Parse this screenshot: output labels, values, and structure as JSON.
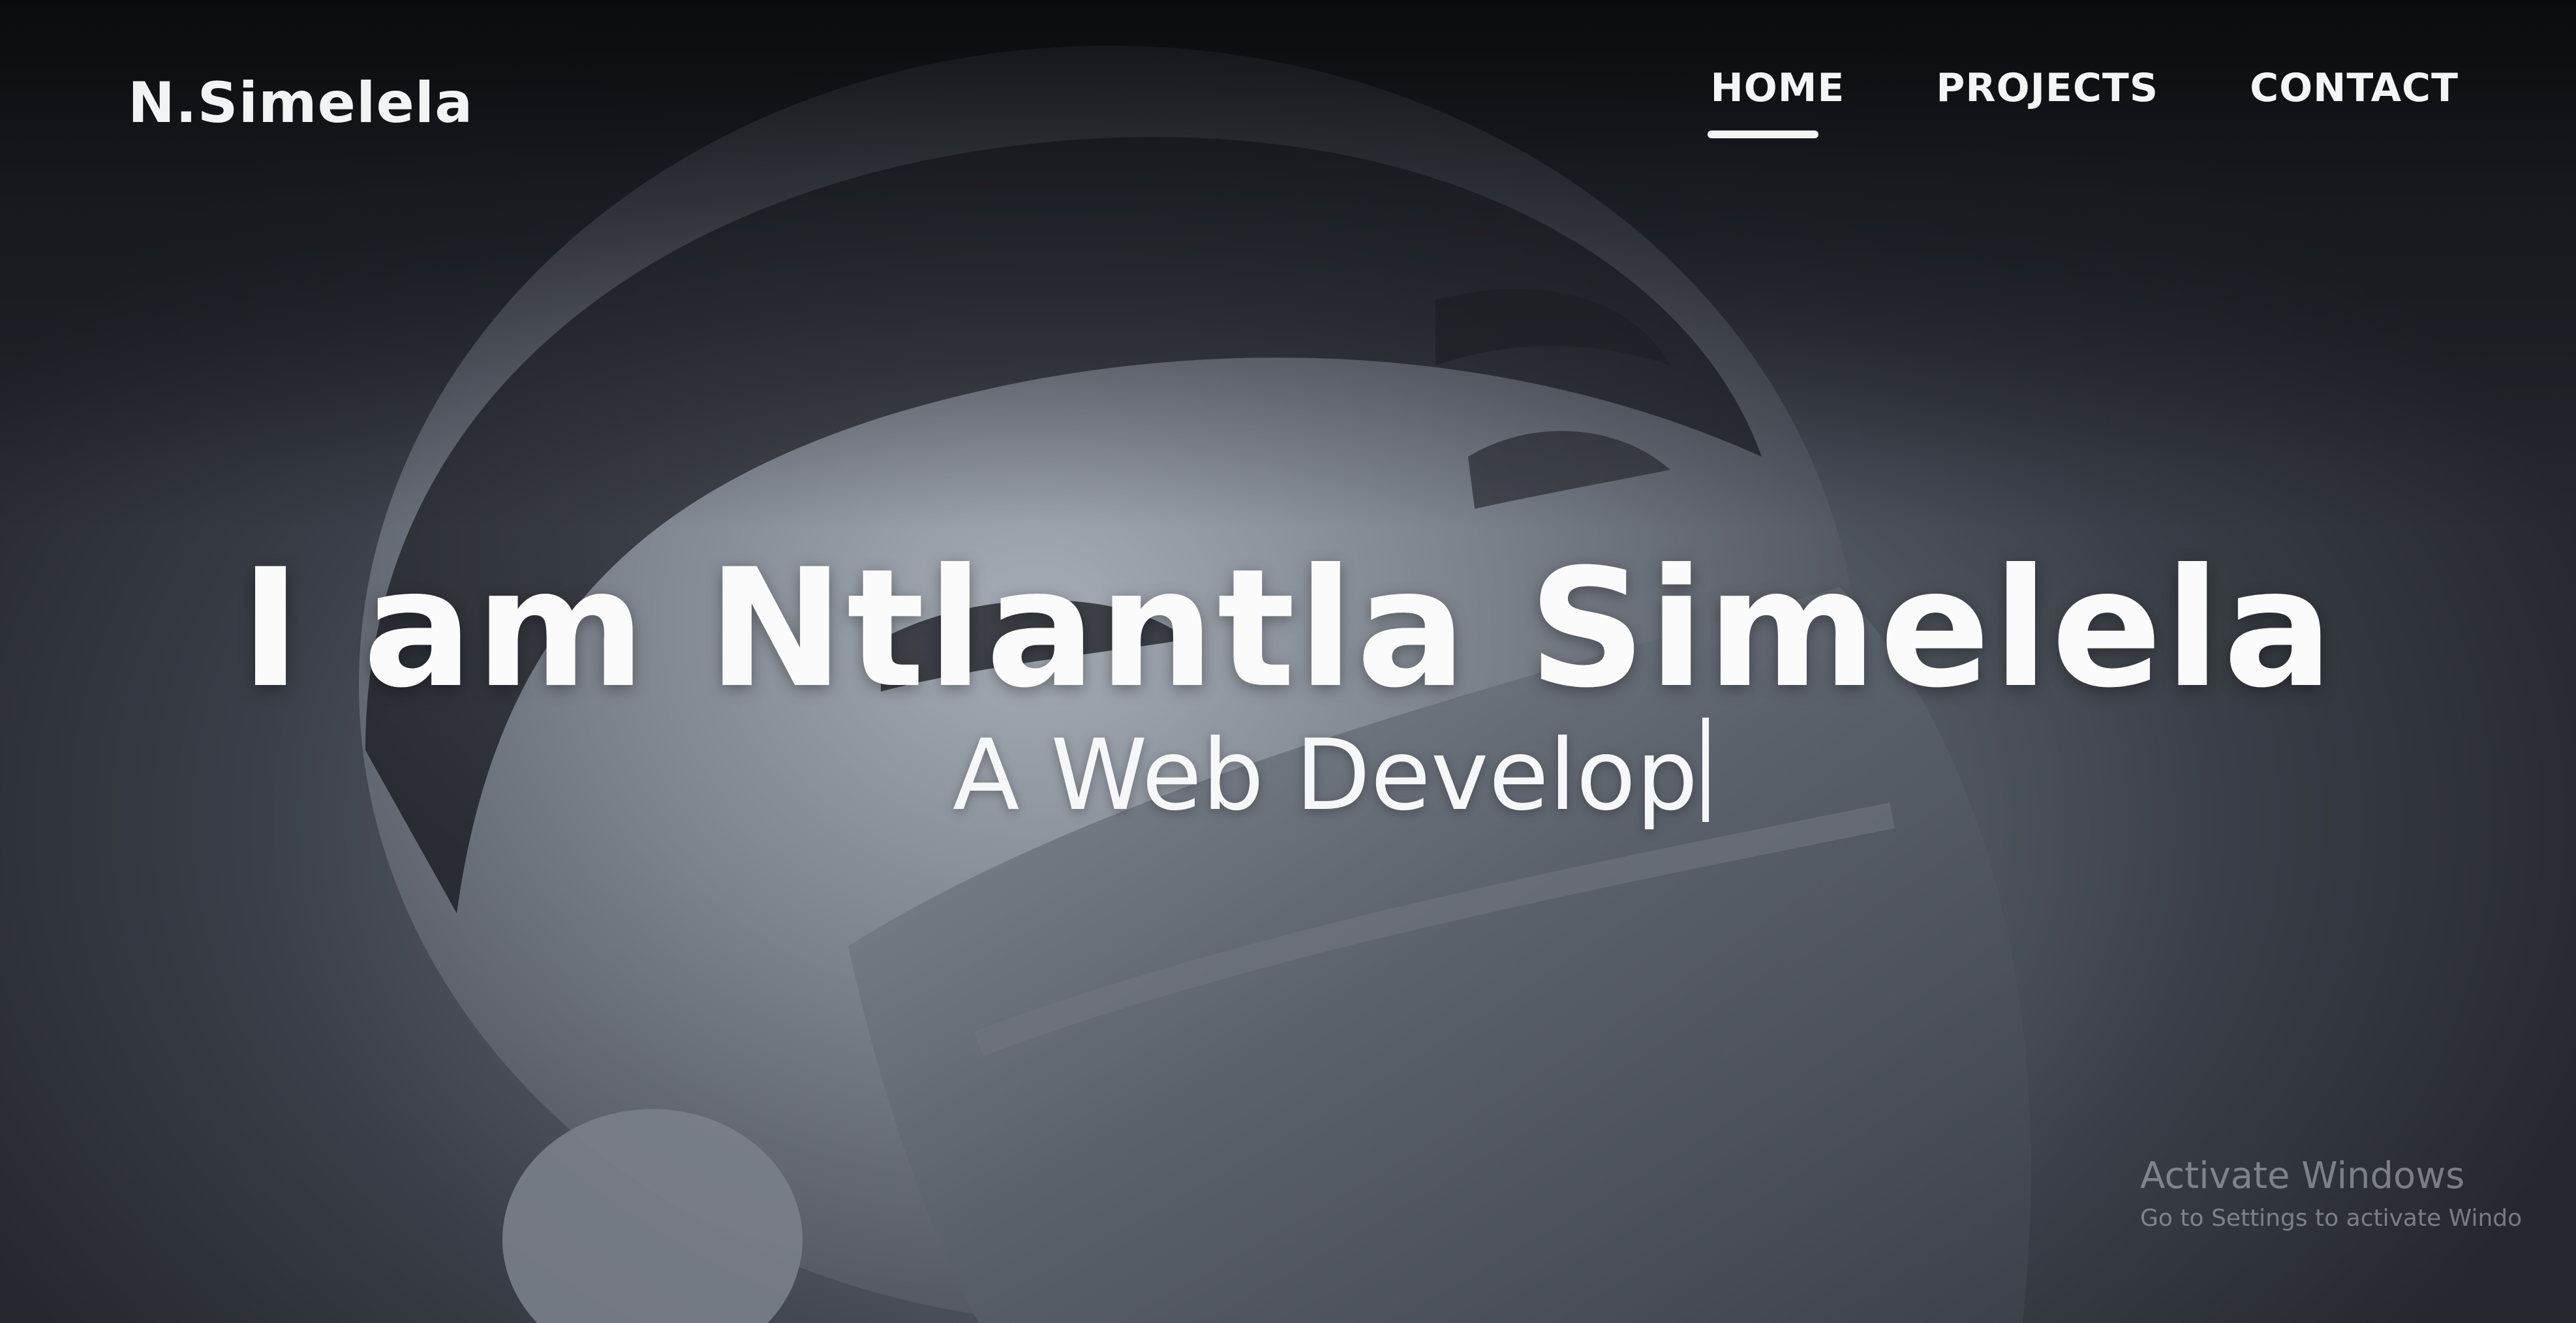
{
  "header": {
    "brand": "N.Simelela",
    "nav": [
      {
        "label": "HOME",
        "active": true
      },
      {
        "label": "PROJECTS",
        "active": false
      },
      {
        "label": "CONTACT",
        "active": false
      }
    ]
  },
  "hero": {
    "title": "I am Ntlantla Simelela",
    "subtitle": "A Web Develop"
  },
  "watermark": {
    "title": "Activate Windows",
    "subtitle": "Go to Settings to activate Windo"
  },
  "colors": {
    "text": "#ffffff",
    "background_dark": "#0c0e12",
    "background_mid": "#5d636d"
  }
}
